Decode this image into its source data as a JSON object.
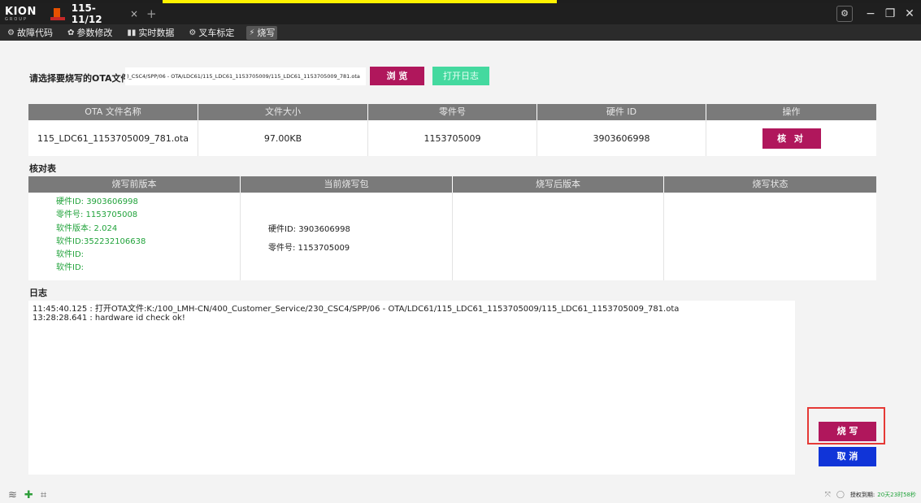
{
  "titlebar": {
    "logo_text": "KION",
    "logo_sub": "GROUP",
    "tab_label": "115-11/12",
    "tab_close": "×",
    "tab_add": "+",
    "settings_glyph": "⚙",
    "minimize_glyph": "−",
    "restore_glyph": "❐",
    "close_glyph": "✕"
  },
  "menu": {
    "items": [
      {
        "label": "故障代码",
        "icon": "fault-icon"
      },
      {
        "label": "参数修改",
        "icon": "gear-icon"
      },
      {
        "label": "实时数据",
        "icon": "chart-icon"
      },
      {
        "label": "叉车标定",
        "icon": "forklift-icon"
      },
      {
        "label": "烧写",
        "icon": "flash-icon"
      }
    ]
  },
  "file_select": {
    "label": "请选择要烧写的OTA文件",
    "path": ")_CSC4/SPP/06 - OTA/LDC61/115_LDC61_1153705009/115_LDC61_1153705009_781.ota",
    "browse_label": "浏 览",
    "open_log_label": "打开日志"
  },
  "ota_table": {
    "headers": [
      "OTA 文件名称",
      "文件大小",
      "零件号",
      "硬件 ID",
      "操作"
    ],
    "row": {
      "file_name": "115_LDC61_1153705009_781.ota",
      "file_size": "97.00KB",
      "part_no": "1153705009",
      "hardware_id": "3903606998",
      "action_label": "核 对"
    }
  },
  "check_table": {
    "title": "核对表",
    "headers": [
      "烧写前版本",
      "当前烧写包",
      "烧写后版本",
      "烧写状态"
    ],
    "before_lines": [
      "硬件ID: 3903606998",
      "零件号: 1153705008",
      "软件版本: 2.024",
      "软件ID:352232106638",
      "软件ID:",
      "软件ID:"
    ],
    "current_lines": [
      "硬件ID: 3903606998",
      "零件号: 1153705009"
    ]
  },
  "log": {
    "title": "日志",
    "lines": [
      "11:45:40.125 : 打开OTA文件:K:/100_LMH-CN/400_Customer_Service/230_CSC4/SPP/06 - OTA/LDC61/115_LDC61_1153705009/115_LDC61_1153705009_781.ota",
      "13:28:28.641 : hardware id check ok!"
    ]
  },
  "actions": {
    "burn_label": "烧 写",
    "cancel_label": "取 消"
  },
  "statusbar": {
    "license_label": "授权到期:",
    "license_value": "20天23时58秒"
  },
  "colors": {
    "primary": "#b0175c",
    "accent_green": "#44d99f",
    "cancel_blue": "#1034d8",
    "status_green": "#21a33b"
  }
}
